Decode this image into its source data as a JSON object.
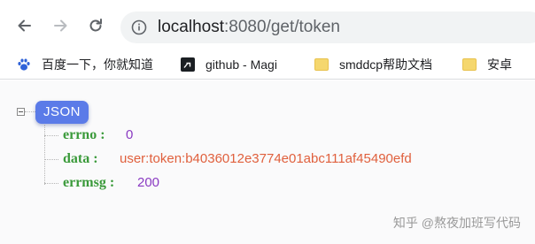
{
  "browser": {
    "url_host": "localhost",
    "url_rest": ":8080/get/token",
    "bookmarks": [
      {
        "label": "百度一下，你就知道",
        "icon": "baidu-paw-icon"
      },
      {
        "label": "github - Magi",
        "icon": "github-icon"
      },
      {
        "label": "smddcp帮助文档",
        "icon": "folder-icon"
      },
      {
        "label": "安卓",
        "icon": "folder-icon"
      }
    ]
  },
  "json_view": {
    "badge": "JSON",
    "rows": [
      {
        "key": "errno :",
        "value": "0",
        "kind": "number"
      },
      {
        "key": "data :",
        "value": "user:token:b4036012e3774e01abc111af45490efd",
        "kind": "string"
      },
      {
        "key": "errmsg :",
        "value": "200",
        "kind": "number"
      }
    ]
  },
  "watermark": "知乎 @熬夜加班写代码",
  "colors": {
    "badge_bg": "#5b7be8",
    "key": "#3a9a3a",
    "number": "#8a3ac2",
    "string": "#e0603d"
  }
}
